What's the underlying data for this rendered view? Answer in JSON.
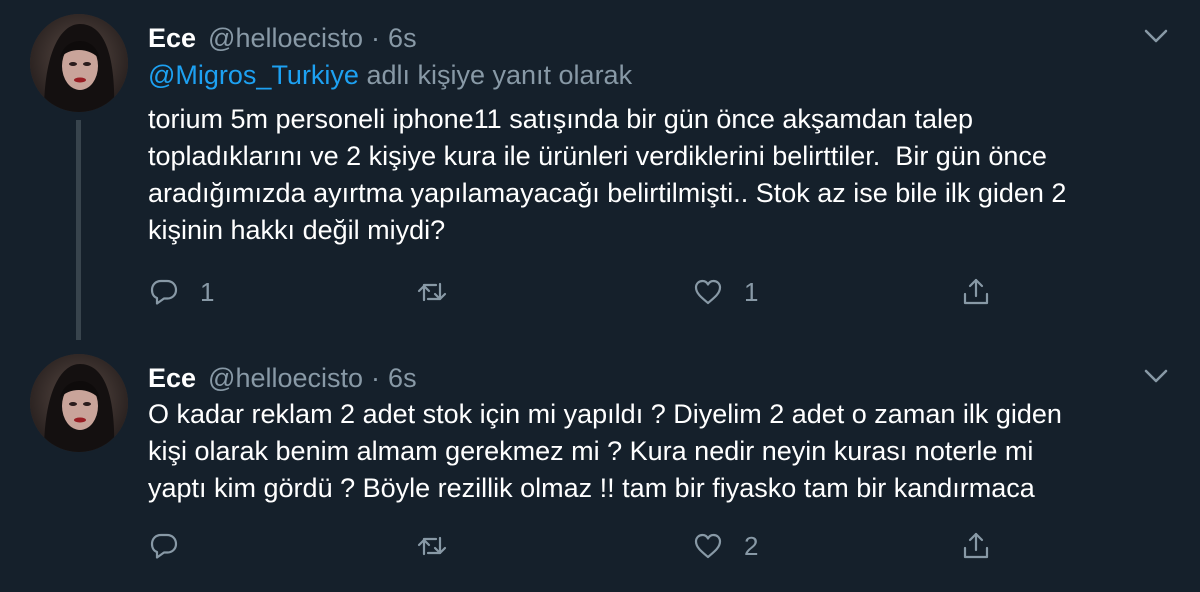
{
  "tweets": [
    {
      "name": "Ece",
      "handle": "@helloecisto",
      "separator": "·",
      "time": "6s",
      "reply_to": {
        "mention": "@Migros_Turkiye",
        "suffix": " adlı kişiye yanıt olarak"
      },
      "text": "torium 5m personeli iphone11 satışında bir gün önce akşamdan talep\ntopladıklarını ve 2 kişiye kura ile ürünleri verdiklerini belirttiler.  Bir gün önce\naradığımızda ayırtma yapılamayacağı belirtilmişti.. Stok az ise bile ilk giden 2\nkişinin hakkı değil miydi?",
      "actions": {
        "reply_count": "1",
        "retweet_count": "",
        "like_count": "1"
      }
    },
    {
      "name": "Ece",
      "handle": "@helloecisto",
      "separator": "·",
      "time": "6s",
      "text": "O kadar reklam 2 adet stok için mi yapıldı ? Diyelim 2 adet o zaman ilk giden\nkişi olarak benim almam gerekmez mi ? Kura nedir neyin kurası noterle mi\nyaptı kim gördü ? Böyle rezillik olmaz !! tam bir fiyasko tam bir kandırmaca",
      "actions": {
        "reply_count": "",
        "retweet_count": "",
        "like_count": "2"
      }
    }
  ],
  "icons": {
    "reply": "reply-icon",
    "retweet": "retweet-icon",
    "like": "heart-icon",
    "share": "share-icon",
    "menu": "chevron-down-icon"
  },
  "colors": {
    "background": "#15202b",
    "text": "#ffffff",
    "secondary": "#8899a6",
    "link": "#1da1f2",
    "thread_line": "#38444d"
  }
}
